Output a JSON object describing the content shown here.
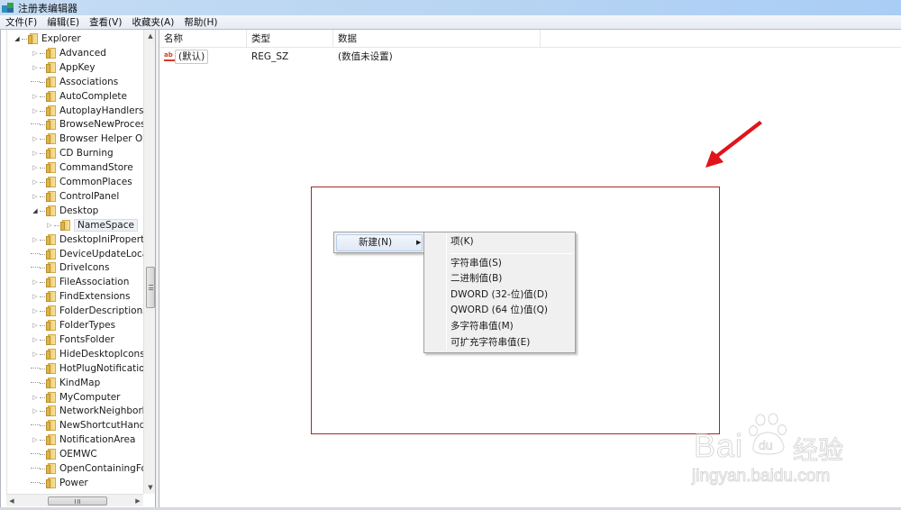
{
  "window": {
    "title": "注册表编辑器",
    "icon": "regedit-icon"
  },
  "menubar": {
    "items": [
      {
        "label": "文件(F)"
      },
      {
        "label": "编辑(E)"
      },
      {
        "label": "查看(V)"
      },
      {
        "label": "收藏夹(A)"
      },
      {
        "label": "帮助(H)"
      }
    ]
  },
  "tree": {
    "root": {
      "label": "Explorer",
      "expanded": true
    },
    "items": [
      {
        "label": "Advanced",
        "expander": "collapsed"
      },
      {
        "label": "AppKey",
        "expander": "collapsed"
      },
      {
        "label": "Associations",
        "expander": "none"
      },
      {
        "label": "AutoComplete",
        "expander": "collapsed"
      },
      {
        "label": "AutoplayHandlers",
        "expander": "collapsed"
      },
      {
        "label": "BrowseNewProcess",
        "expander": "none"
      },
      {
        "label": "Browser Helper Obje",
        "expander": "collapsed"
      },
      {
        "label": "CD Burning",
        "expander": "collapsed"
      },
      {
        "label": "CommandStore",
        "expander": "collapsed"
      },
      {
        "label": "CommonPlaces",
        "expander": "collapsed"
      },
      {
        "label": "ControlPanel",
        "expander": "collapsed"
      },
      {
        "label": "Desktop",
        "expander": "expanded"
      },
      {
        "label": "NameSpace",
        "expander": "collapsed",
        "child": true,
        "selected": true
      },
      {
        "label": "DesktopIniPropertyM",
        "expander": "collapsed"
      },
      {
        "label": "DeviceUpdateLocatic",
        "expander": "none"
      },
      {
        "label": "DriveIcons",
        "expander": "none"
      },
      {
        "label": "FileAssociation",
        "expander": "collapsed"
      },
      {
        "label": "FindExtensions",
        "expander": "collapsed"
      },
      {
        "label": "FolderDescriptions",
        "expander": "collapsed"
      },
      {
        "label": "FolderTypes",
        "expander": "collapsed"
      },
      {
        "label": "FontsFolder",
        "expander": "collapsed"
      },
      {
        "label": "HideDesktopIcons",
        "expander": "collapsed"
      },
      {
        "label": "HotPlugNotification",
        "expander": "none"
      },
      {
        "label": "KindMap",
        "expander": "none"
      },
      {
        "label": "MyComputer",
        "expander": "collapsed"
      },
      {
        "label": "NetworkNeighborho",
        "expander": "collapsed"
      },
      {
        "label": "NewShortcutHandler",
        "expander": "none"
      },
      {
        "label": "NotificationArea",
        "expander": "collapsed"
      },
      {
        "label": "OEMWC",
        "expander": "none"
      },
      {
        "label": "OpenContainingFold",
        "expander": "none"
      },
      {
        "label": "Power",
        "expander": "none"
      }
    ]
  },
  "list": {
    "columns": [
      {
        "label": "名称"
      },
      {
        "label": "类型"
      },
      {
        "label": "数据"
      }
    ],
    "rows": [
      {
        "icon": "string-value-icon",
        "icon_text": "ab",
        "name": "(默认)",
        "type": "REG_SZ",
        "data": "(数值未设置)"
      }
    ]
  },
  "context_menu": {
    "items": [
      {
        "label": "新建(N)",
        "has_submenu": true
      }
    ]
  },
  "submenu": {
    "items": [
      {
        "label": "项(K)"
      },
      {
        "label": "字符串值(S)"
      },
      {
        "label": "二进制值(B)"
      },
      {
        "label": "DWORD (32-位)值(D)"
      },
      {
        "label": "QWORD (64 位)值(Q)"
      },
      {
        "label": "多字符串值(M)"
      },
      {
        "label": "可扩充字符串值(E)"
      }
    ]
  },
  "annotation": {
    "color": "#a22a2a",
    "arrow_color": "#e0141a"
  },
  "watermark": {
    "brand": "Bai",
    "paw_text": "du",
    "cn": "经验",
    "url": "jingyan.baidu.com"
  }
}
